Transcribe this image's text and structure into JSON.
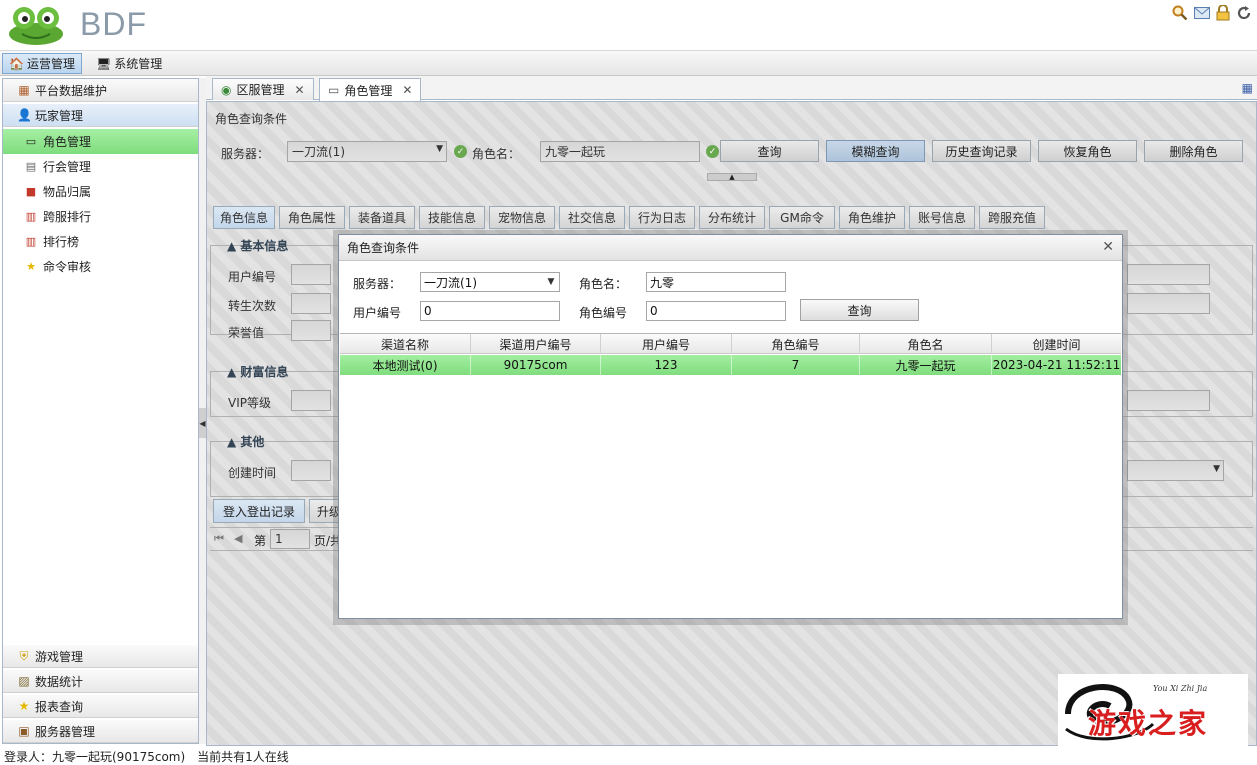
{
  "app": {
    "logo_text": "BDF"
  },
  "header_icons": [
    "search-icon",
    "mail-icon",
    "lock-icon",
    "refresh-icon"
  ],
  "top_menu": [
    {
      "label": "运营管理",
      "icon": "home-icon",
      "active": true
    },
    {
      "label": "系统管理",
      "icon": "monitor-icon",
      "active": false
    }
  ],
  "sidebar": {
    "sections_top": [
      {
        "label": "平台数据维护",
        "icon": "grid-icon"
      },
      {
        "label": "玩家管理",
        "icon": "user-icon"
      }
    ],
    "tree": [
      {
        "label": "角色管理",
        "icon": "id-card-icon",
        "selected": true
      },
      {
        "label": "行会管理",
        "icon": "building-icon",
        "selected": false
      },
      {
        "label": "物品归属",
        "icon": "gift-icon",
        "selected": false
      },
      {
        "label": "跨服排行",
        "icon": "chart-icon",
        "selected": false
      },
      {
        "label": "排行榜",
        "icon": "chart-icon",
        "selected": false
      },
      {
        "label": "命令审核",
        "icon": "star-icon",
        "selected": false
      }
    ],
    "sections_bottom": [
      {
        "label": "游戏管理",
        "icon": "shield-icon"
      },
      {
        "label": "数据统计",
        "icon": "chart-icon"
      },
      {
        "label": "报表查询",
        "icon": "star-icon"
      },
      {
        "label": "服务器管理",
        "icon": "server-icon"
      }
    ]
  },
  "main_tabs": [
    {
      "label": "区服管理",
      "icon": "globe-icon",
      "active": false
    },
    {
      "label": "角色管理",
      "icon": "id-card-icon",
      "active": true
    }
  ],
  "query": {
    "title": "角色查询条件",
    "server_label": "服务器：",
    "server_value": "一刀流(1)",
    "role_label": "角色名：",
    "role_value": "九零一起玩",
    "buttons": [
      "查询",
      "模糊查询",
      "历史查询记录",
      "恢复角色",
      "删除角色"
    ]
  },
  "sub_tabs": [
    "角色信息",
    "角色属性",
    "装备道具",
    "技能信息",
    "宠物信息",
    "社交信息",
    "行为日志",
    "分布统计",
    "GM命令",
    "角色维护",
    "账号信息",
    "跨服充值"
  ],
  "sections": {
    "basic": {
      "title": "基本信息",
      "fields": [
        "用户编号",
        "转生次数",
        "荣誉值"
      ]
    },
    "wealth": {
      "title": "财富信息",
      "fields": [
        "VIP等级"
      ]
    },
    "other": {
      "title": "其他",
      "fields": [
        "创建时间"
      ]
    }
  },
  "bottom_tabs": [
    "登入登出记录",
    "升级"
  ],
  "pager": {
    "page_label": "第",
    "page_value": "1",
    "total_label": "页/共"
  },
  "modal": {
    "title": "角色查询条件",
    "server_label": "服务器：",
    "server_value": "一刀流(1)",
    "role_label": "角色名：",
    "role_value": "九零",
    "user_label": "用户编号",
    "user_value": "0",
    "roleid_label": "角色编号",
    "roleid_value": "0",
    "query_button": "查询",
    "columns": [
      "渠道名称",
      "渠道用户编号",
      "用户编号",
      "角色编号",
      "角色名",
      "创建时间"
    ],
    "rows": [
      [
        "本地测试(0)",
        "90175com",
        "123",
        "7",
        "九零一起玩",
        "2023-04-21 11:52:11"
      ]
    ]
  },
  "status": {
    "login_label": "登录人：九零一起玩(90175com)",
    "online_label": "当前共有1人在线"
  },
  "watermark": {
    "text": "游戏之家",
    "subtext": "You Xi Zhi Jia"
  },
  "colors": {
    "selected_green": "#80dd7e",
    "accent_blue": "#3b5ea8"
  }
}
